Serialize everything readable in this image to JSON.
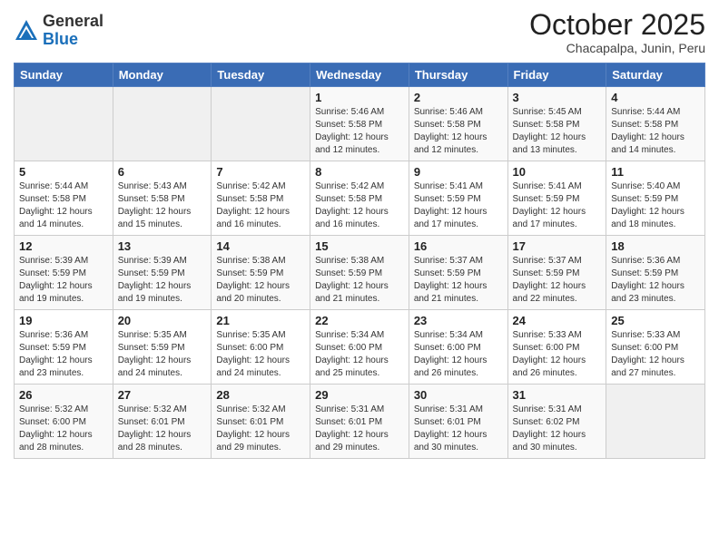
{
  "header": {
    "logo_general": "General",
    "logo_blue": "Blue",
    "month_title": "October 2025",
    "subtitle": "Chacapalpa, Junin, Peru"
  },
  "days_of_week": [
    "Sunday",
    "Monday",
    "Tuesday",
    "Wednesday",
    "Thursday",
    "Friday",
    "Saturday"
  ],
  "weeks": [
    [
      {
        "day": "",
        "info": ""
      },
      {
        "day": "",
        "info": ""
      },
      {
        "day": "",
        "info": ""
      },
      {
        "day": "1",
        "info": "Sunrise: 5:46 AM\nSunset: 5:58 PM\nDaylight: 12 hours\nand 12 minutes."
      },
      {
        "day": "2",
        "info": "Sunrise: 5:46 AM\nSunset: 5:58 PM\nDaylight: 12 hours\nand 12 minutes."
      },
      {
        "day": "3",
        "info": "Sunrise: 5:45 AM\nSunset: 5:58 PM\nDaylight: 12 hours\nand 13 minutes."
      },
      {
        "day": "4",
        "info": "Sunrise: 5:44 AM\nSunset: 5:58 PM\nDaylight: 12 hours\nand 14 minutes."
      }
    ],
    [
      {
        "day": "5",
        "info": "Sunrise: 5:44 AM\nSunset: 5:58 PM\nDaylight: 12 hours\nand 14 minutes."
      },
      {
        "day": "6",
        "info": "Sunrise: 5:43 AM\nSunset: 5:58 PM\nDaylight: 12 hours\nand 15 minutes."
      },
      {
        "day": "7",
        "info": "Sunrise: 5:42 AM\nSunset: 5:58 PM\nDaylight: 12 hours\nand 16 minutes."
      },
      {
        "day": "8",
        "info": "Sunrise: 5:42 AM\nSunset: 5:58 PM\nDaylight: 12 hours\nand 16 minutes."
      },
      {
        "day": "9",
        "info": "Sunrise: 5:41 AM\nSunset: 5:59 PM\nDaylight: 12 hours\nand 17 minutes."
      },
      {
        "day": "10",
        "info": "Sunrise: 5:41 AM\nSunset: 5:59 PM\nDaylight: 12 hours\nand 17 minutes."
      },
      {
        "day": "11",
        "info": "Sunrise: 5:40 AM\nSunset: 5:59 PM\nDaylight: 12 hours\nand 18 minutes."
      }
    ],
    [
      {
        "day": "12",
        "info": "Sunrise: 5:39 AM\nSunset: 5:59 PM\nDaylight: 12 hours\nand 19 minutes."
      },
      {
        "day": "13",
        "info": "Sunrise: 5:39 AM\nSunset: 5:59 PM\nDaylight: 12 hours\nand 19 minutes."
      },
      {
        "day": "14",
        "info": "Sunrise: 5:38 AM\nSunset: 5:59 PM\nDaylight: 12 hours\nand 20 minutes."
      },
      {
        "day": "15",
        "info": "Sunrise: 5:38 AM\nSunset: 5:59 PM\nDaylight: 12 hours\nand 21 minutes."
      },
      {
        "day": "16",
        "info": "Sunrise: 5:37 AM\nSunset: 5:59 PM\nDaylight: 12 hours\nand 21 minutes."
      },
      {
        "day": "17",
        "info": "Sunrise: 5:37 AM\nSunset: 5:59 PM\nDaylight: 12 hours\nand 22 minutes."
      },
      {
        "day": "18",
        "info": "Sunrise: 5:36 AM\nSunset: 5:59 PM\nDaylight: 12 hours\nand 23 minutes."
      }
    ],
    [
      {
        "day": "19",
        "info": "Sunrise: 5:36 AM\nSunset: 5:59 PM\nDaylight: 12 hours\nand 23 minutes."
      },
      {
        "day": "20",
        "info": "Sunrise: 5:35 AM\nSunset: 5:59 PM\nDaylight: 12 hours\nand 24 minutes."
      },
      {
        "day": "21",
        "info": "Sunrise: 5:35 AM\nSunset: 6:00 PM\nDaylight: 12 hours\nand 24 minutes."
      },
      {
        "day": "22",
        "info": "Sunrise: 5:34 AM\nSunset: 6:00 PM\nDaylight: 12 hours\nand 25 minutes."
      },
      {
        "day": "23",
        "info": "Sunrise: 5:34 AM\nSunset: 6:00 PM\nDaylight: 12 hours\nand 26 minutes."
      },
      {
        "day": "24",
        "info": "Sunrise: 5:33 AM\nSunset: 6:00 PM\nDaylight: 12 hours\nand 26 minutes."
      },
      {
        "day": "25",
        "info": "Sunrise: 5:33 AM\nSunset: 6:00 PM\nDaylight: 12 hours\nand 27 minutes."
      }
    ],
    [
      {
        "day": "26",
        "info": "Sunrise: 5:32 AM\nSunset: 6:00 PM\nDaylight: 12 hours\nand 28 minutes."
      },
      {
        "day": "27",
        "info": "Sunrise: 5:32 AM\nSunset: 6:01 PM\nDaylight: 12 hours\nand 28 minutes."
      },
      {
        "day": "28",
        "info": "Sunrise: 5:32 AM\nSunset: 6:01 PM\nDaylight: 12 hours\nand 29 minutes."
      },
      {
        "day": "29",
        "info": "Sunrise: 5:31 AM\nSunset: 6:01 PM\nDaylight: 12 hours\nand 29 minutes."
      },
      {
        "day": "30",
        "info": "Sunrise: 5:31 AM\nSunset: 6:01 PM\nDaylight: 12 hours\nand 30 minutes."
      },
      {
        "day": "31",
        "info": "Sunrise: 5:31 AM\nSunset: 6:02 PM\nDaylight: 12 hours\nand 30 minutes."
      },
      {
        "day": "",
        "info": ""
      }
    ]
  ]
}
